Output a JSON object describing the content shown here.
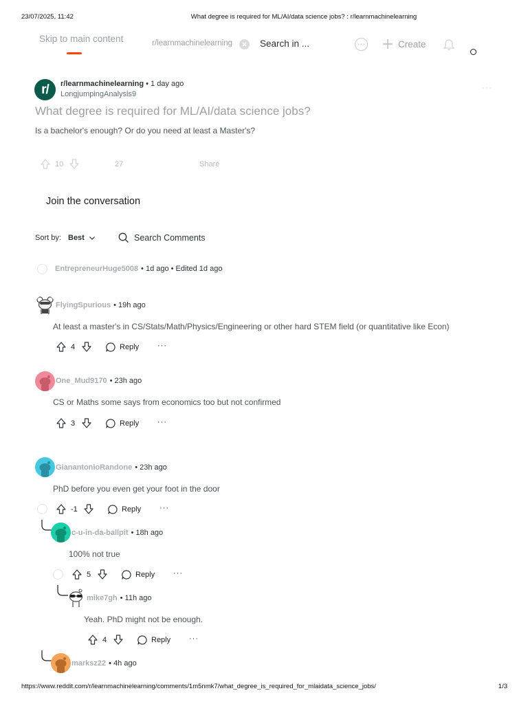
{
  "print": {
    "date": "23/07/2025, 11:42",
    "title": "What degree is required for ML/AI/data science jobs? : r/learnmachinelearning",
    "url": "https://www.reddit.com/r/learnmachinelearning/comments/1m5nmk7/what_degree_is_required_for_mlaidata_science_jobs/",
    "page": "1/3"
  },
  "nav": {
    "skip_link": "Skip to main content",
    "subreddit_chip": "r/learnmachinelearning",
    "search_text": "Search in ...",
    "create_label": "Create",
    "accent_color": "#ff4500"
  },
  "post": {
    "avatar_text": "r/",
    "subreddit": "r/learnmachinelearning",
    "time": "1 day ago",
    "author": "LongjumpingAnalysis9",
    "more": "···",
    "title": "What degree is required for ML/AI/data science jobs?",
    "body": "Is a bachelor's enough? Or do you need at least a Master's?",
    "score": "10",
    "comments": "27",
    "share": "Share"
  },
  "join": {
    "label": "Join the conversation"
  },
  "sort": {
    "label": "Sort by:",
    "value": "Best",
    "search_label": "Search Comments"
  },
  "comments": [
    {
      "author": "EntrepreneurHuge5008",
      "meta": "• 1d ago • Edited 1d ago"
    },
    {
      "author": "FlyingSpurious",
      "meta": "• 19h ago",
      "body": "At least a master's in CS/Stats/Math/Physics/Engineering or other hard STEM field (or quantitative like Econ)",
      "score": "4",
      "reply": "Reply",
      "more": "···",
      "avatar_color": "#ffffff"
    },
    {
      "author": "One_Mud9170",
      "meta": "• 23h ago",
      "body": "CS or Maths some says from economics too but not confirmed",
      "score": "3",
      "reply": "Reply",
      "more": "···",
      "avatar_color": "#f08a9a"
    },
    {
      "author": "GianantonioRandone",
      "meta": "• 23h ago",
      "body": "PhD before you even get your foot in the door",
      "score": "-1",
      "reply": "Reply",
      "more": "···",
      "avatar_color": "#46c8e0"
    },
    {
      "author": "c-u-in-da-ballpit",
      "meta": "• 18h ago",
      "body": "100% not true",
      "score": "5",
      "reply": "Reply",
      "more": "···",
      "avatar_color": "#1ccfaa"
    },
    {
      "author": "mike7gh",
      "meta": "• 11h ago",
      "body": "Yeah. PhD might not be enough.",
      "score": "4",
      "reply": "Reply",
      "more": "···",
      "avatar_color": "#ffffff"
    },
    {
      "author": "marksz22",
      "meta": "• 4h ago",
      "avatar_color": "#f5a25a"
    }
  ]
}
